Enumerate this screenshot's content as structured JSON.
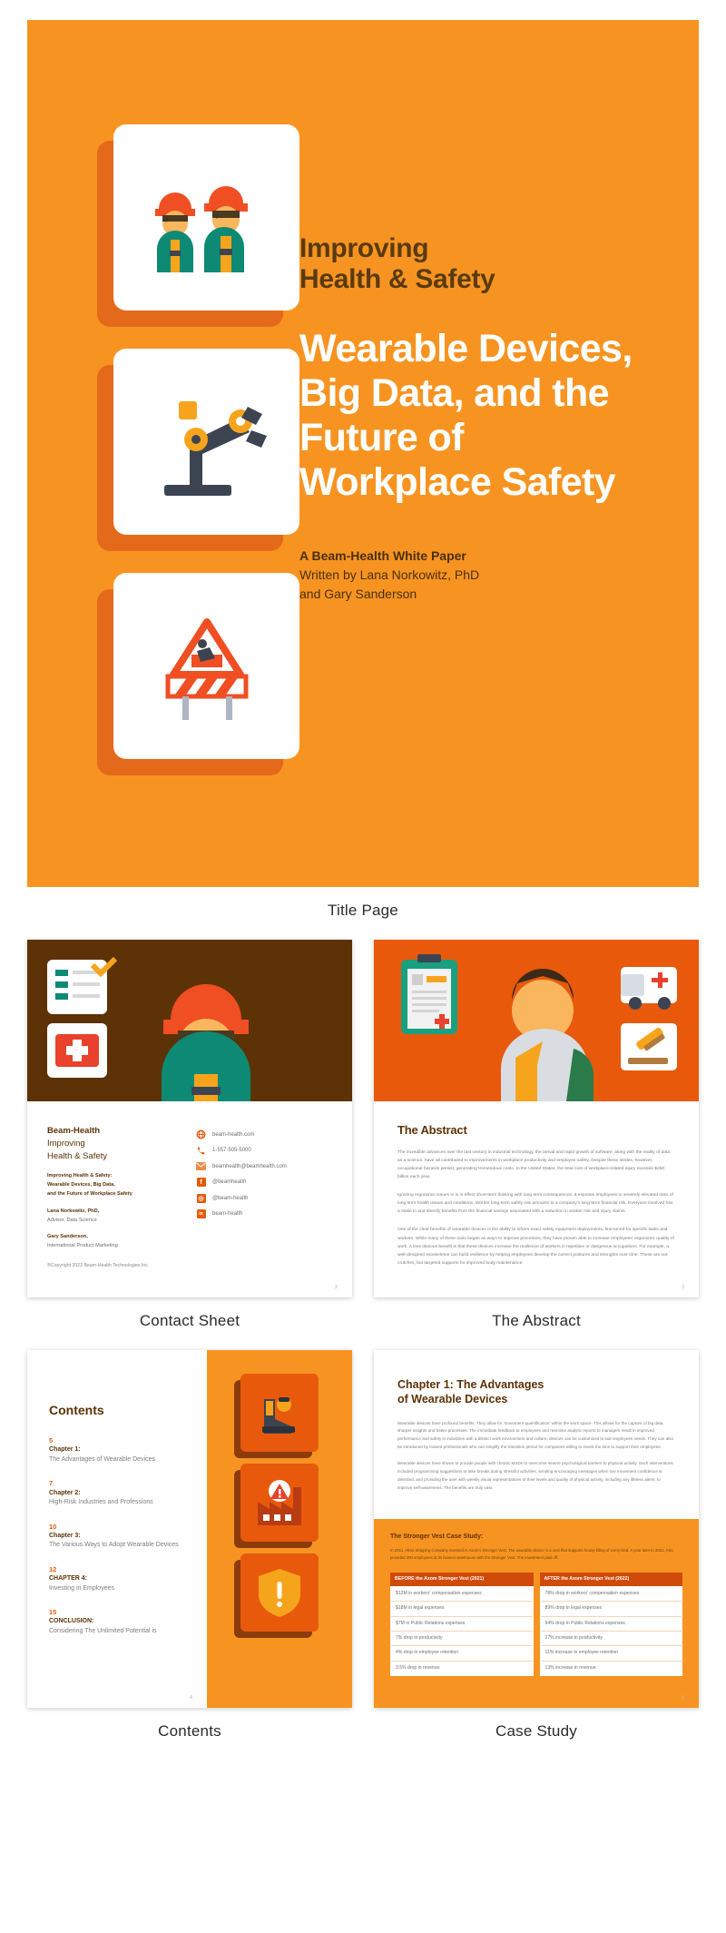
{
  "document": {
    "brand_orange": "#f79421",
    "deep_orange": "#e8590c",
    "brown": "#5c3206"
  },
  "title_page": {
    "caption": "Title Page",
    "kicker": "Improving\nHealth & Safety",
    "main_title": "Wearable Devices, Big Data, and the Future of Workplace Safety",
    "byline_strong": "A Beam-Health White Paper",
    "byline_line1": "Written by Lana Norkowitz, PhD",
    "byline_line2": "and Gary Sanderson",
    "icons": [
      "construction-workers-icon",
      "robot-arm-icon",
      "road-work-sign-icon"
    ]
  },
  "contact_sheet": {
    "caption": "Contact Sheet",
    "page_number": "2",
    "brand_line1": "Beam-Health",
    "brand_line2": "Improving",
    "brand_line3": "Health & Safety",
    "sub_line1": "Improving Health & Safety:",
    "sub_line2": "Wearable Devices, Big Data,",
    "sub_line3": "and the Future of Workplace Safety",
    "person1_name": "Lana Norkowitz, PhD,",
    "person1_role": "Advisor, Data Science",
    "person2_name": "Gary Sanderson,",
    "person2_role": "International Product Marketing",
    "copyright": "®Copyright 2023 Beam-Health Technologies Inc.",
    "contacts": [
      {
        "icon": "globe-icon",
        "text": "beam-health.com"
      },
      {
        "icon": "phone-icon",
        "text": "1-557-505-5000"
      },
      {
        "icon": "envelope-icon",
        "text": "beamhealth@beamhealth.com"
      },
      {
        "icon": "facebook-icon",
        "glyph": "f",
        "text": "@beamhealth"
      },
      {
        "icon": "instagram-icon",
        "glyph": "◎",
        "text": "@beam-health"
      },
      {
        "icon": "linkedin-icon",
        "glyph": "in",
        "text": "beam-health"
      }
    ]
  },
  "abstract_page": {
    "caption": "The Abstract",
    "page_number": "3",
    "heading": "The Abstract",
    "paragraphs": [
      "The incredible advances over the last century in industrial technology, the arrival and rapid growth of software, along with the reality of data as a science, have all contributed to improvements in workplace productivity and employee safety. Despite these strides, however, occupational hazards persist, generating tremendous costs. In the United States, the total cost of workplace-related injury exceeds $250 billion each year.",
      "Ignoring ergonomic issues in is in effect short-term thinking with long term consequences. It exposes employees to severely elevated risks of long term health issues and conditions. Worker long-term safety risk amounts to a company's long-term financial risk. Everyone involved has a stake in and directly benefits from the financial savings associated with a reduction in worker risk and injury claims.",
      "One of the clear benefits of wearable devices is the ability to inform exact safety equipment deployments, fine-tuned for specific tasks and workers. While many of these tools began as ways to improve processes, they have proven able to increase employees' ergonomic quality of work. A less obvious benefit is that these devices increase the resilience of workers in repetitive or dangerous occupations. For example, a well-designed exoskeleton can build resilience by helping employees develop the correct postures and strengths over time. These are not crutches, but targeted supports for improved body maintenance."
    ]
  },
  "contents_page": {
    "caption": "Contents",
    "page_number": "4",
    "heading": "Contents",
    "entries": [
      {
        "number": "5",
        "chapter": "Chapter 1:",
        "title": "The Advantages of Wearable Devices"
      },
      {
        "number": "7",
        "chapter": "Chapter 2:",
        "title": "High-Risk Industries and Professions"
      },
      {
        "number": "10",
        "chapter": "Chapter 3:",
        "title": "The Various Ways to Adopt Wearable Devices"
      },
      {
        "number": "12",
        "chapter": "CHAPTER 4:",
        "title": "Investing in Employees"
      },
      {
        "number": "15",
        "chapter": "CONCLUSION:",
        "title": "Considering The Unlimited Potential is"
      }
    ],
    "icons": [
      "safety-boot-icon",
      "factory-warning-icon",
      "shield-alert-icon"
    ]
  },
  "case_study_page": {
    "caption": "Case Study",
    "page_number": "5",
    "heading_line1": "Chapter 1: The Advantages",
    "heading_line2": "of Wearable Devices",
    "paragraphs": [
      "Wearable devices have profound benefits. They allow for 'movement quantification' within the work space. This allows for the capture of big data, sharper insights and better processes. The immediate feedback to employees and real-time analytic reports to managers result in improved performance and safety in industries with a distinct work environment and culture, devices can be customized to suit employees needs. They can also be introduced by trained professionals who can simplify the transition period for companies willing to invest the time to support their employees.",
      "Wearable devices have shown to provide people with chronic MSDs to overcome severe psychological barriers to physical activity. Such interventions included programming suggestions to take breaks during stressful activities, sending encouraging messages when low movement confidence is detected, and providing the user with weekly visual representations of their levels and quality of physical activity, including any lifeless alerts, to improve self-awareness. The benefits are truly vast."
    ],
    "band_heading": "The Stronger Vest Case Study:",
    "band_paragraph": "In 2021, Alton Shipping Company invested in Axom's Stronger Vest. The wearable device is a vest that supports heavy-lifting of every kind. A year later in 2022, ASC provided 200 employees at its busiest warehouse with the Stronger Vest. The investment paid off.",
    "table": {
      "columns": [
        {
          "header": "BEFORE the Axom Stronger Vest (2021)",
          "rows": [
            "$12M in workers' compensation expenses",
            "$18M in legal expenses",
            "$7M in Public Relations expenses",
            "7% drop in productivity",
            "4% drop in employee retention",
            "3.5% drop in revenue"
          ]
        },
        {
          "header": "AFTER the Axom Stronger Vest (2022)",
          "rows": [
            "78% drop in workers' compensation expenses",
            "89% drop in legal expenses",
            "94% drop in Public Relations expenses",
            "27% increase in productivity",
            "11% increase in employee retention",
            "13% increase in revenue"
          ]
        }
      ]
    }
  }
}
